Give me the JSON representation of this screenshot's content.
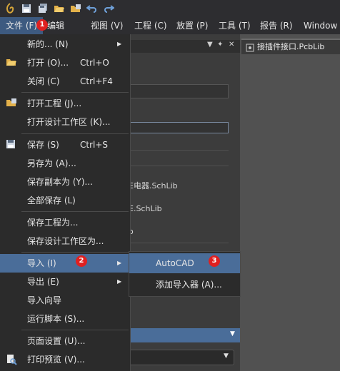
{
  "toolbar": {
    "icons": [
      "app-logo-icon",
      "save-icon",
      "save-all-icon",
      "open-folder-icon",
      "open-project-icon",
      "undo-icon",
      "redo-icon"
    ]
  },
  "menubar": {
    "file": "文件 (F)",
    "edit": "编辑",
    "view": "视图 (V)",
    "project": "工程 (C)",
    "place": "放置 (P)",
    "tools": "工具 (T)",
    "reports": "报告 (R)",
    "window": "Window"
  },
  "document_tab": {
    "label": "接插件接口.PcbLib"
  },
  "background_panel": {
    "text1": "E电器.SchLib",
    "text2": "E.SchLib",
    "text3": "o"
  },
  "file_menu": {
    "new": "新的... (N)",
    "open": "打开 (O)...",
    "open_shortcut": "Ctrl+O",
    "close": "关闭 (C)",
    "close_shortcut": "Ctrl+F4",
    "open_project": "打开工程 (J)...",
    "open_workspace": "打开设计工作区 (K)...",
    "save": "保存 (S)",
    "save_shortcut": "Ctrl+S",
    "save_as": "另存为 (A)...",
    "save_copy_as": "保存副本为 (Y)...",
    "save_all": "全部保存 (L)",
    "save_project_as": "保存工程为...",
    "save_workspace_as": "保存设计工作区为...",
    "import": "导入 (I)",
    "export": "导出 (E)",
    "import_wizard": "导入向导",
    "run_script": "运行脚本 (S)...",
    "page_setup": "页面设置 (U)...",
    "print_preview": "打印预览 (V)..."
  },
  "import_submenu": {
    "autocad": "AutoCAD",
    "add_importer": "添加导入器 (A)..."
  },
  "badges": {
    "b1": "1",
    "b2": "2",
    "b3": "3"
  },
  "colors": {
    "highlight": "#4a6d99",
    "badge": "#e02020",
    "menu_bg": "#2b2b2b"
  }
}
